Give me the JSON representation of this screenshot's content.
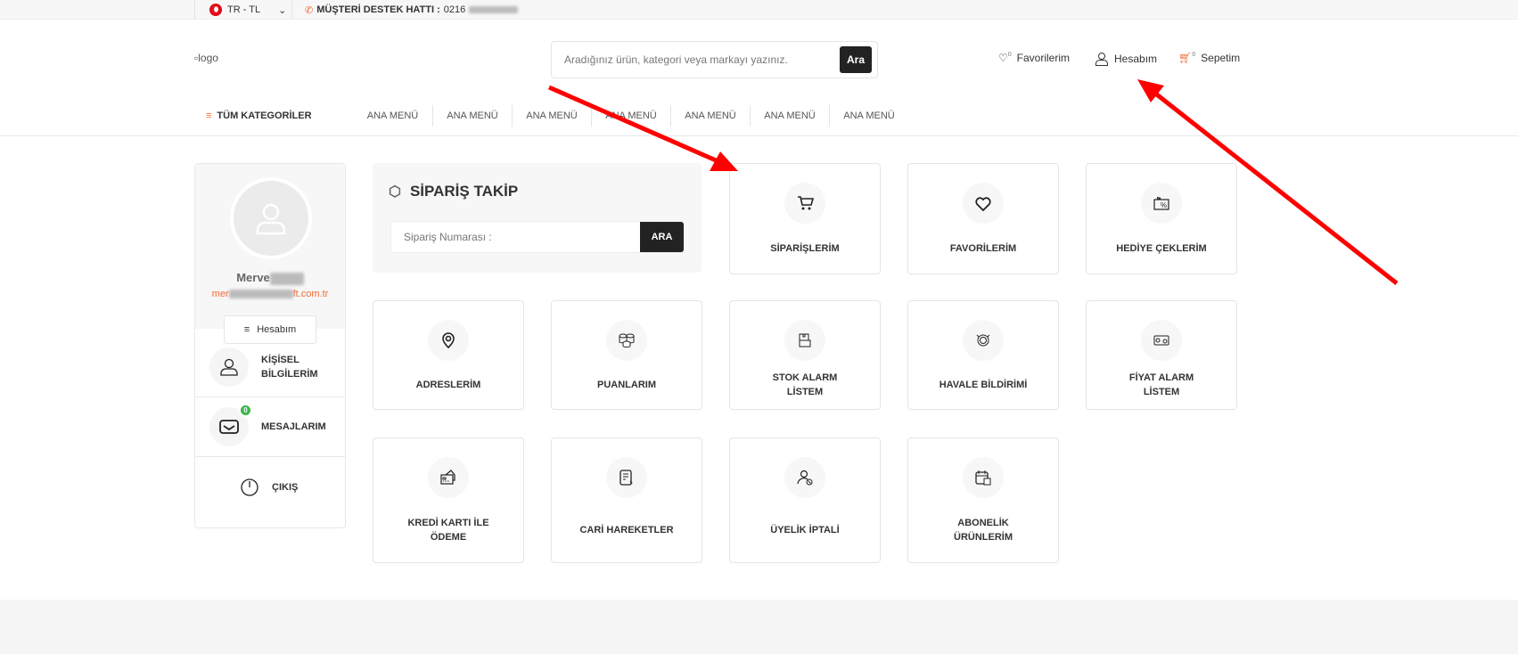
{
  "topbar": {
    "lang": "TR - TL",
    "support_label": "MÜŞTERİ DESTEK HATTI :",
    "support_phone": "0216"
  },
  "header": {
    "logo_alt": "logo",
    "search_placeholder": "Aradığınız ürün, kategori veya markayı yazınız.",
    "search_button": "Ara",
    "favorites": "Favorilerim",
    "favorites_count": "0",
    "account": "Hesabım",
    "cart": "Sepetim",
    "cart_count": "0"
  },
  "nav": {
    "all_categories": "TÜM KATEGORİLER",
    "items": [
      "ANA MENÜ",
      "ANA MENÜ",
      "ANA MENÜ",
      "ANA MENÜ",
      "ANA MENÜ",
      "ANA MENÜ",
      "ANA MENÜ"
    ]
  },
  "sidebar": {
    "name": "Merve",
    "email_start": "mer",
    "email_end": "ft.com.tr",
    "account_button": "Hesabım",
    "items": [
      {
        "label": "KİŞİSEL BİLGİLERİM",
        "icon": "user-icon"
      },
      {
        "label": "MESAJLARIM",
        "icon": "mail-icon",
        "badge": "0"
      },
      {
        "label": "ÇIKIŞ",
        "icon": "power-icon"
      }
    ]
  },
  "tracking": {
    "title": "SİPARİŞ TAKİP",
    "placeholder": "Sipariş Numarası :",
    "button": "ARA"
  },
  "cards": [
    {
      "label": "SİPARİŞLERİM",
      "icon": "cart-icon"
    },
    {
      "label": "FAVORİLERİM",
      "icon": "heart-icon"
    },
    {
      "label": "HEDİYE ÇEKLERİM",
      "icon": "gift-voucher-icon"
    },
    {
      "label": "ADRESLERİM",
      "icon": "location-pin-icon"
    },
    {
      "label": "PUANLARIM",
      "icon": "coins-icon"
    },
    {
      "label": "STOK ALARM LİSTEM",
      "icon": "stock-box-icon"
    },
    {
      "label": "HAVALE BİLDİRİMİ",
      "icon": "money-transfer-icon"
    },
    {
      "label": "FİYAT ALARM LİSTEM",
      "icon": "price-tag-icon"
    },
    {
      "label": "KREDİ KARTI İLE ÖDEME",
      "icon": "credit-card-icon"
    },
    {
      "label": "CARİ HAREKETLER",
      "icon": "statement-icon"
    },
    {
      "label": "ÜYELİK İPTALİ",
      "icon": "user-cancel-icon"
    },
    {
      "label": "ABONELİK ÜRÜNLERİM",
      "icon": "calendar-icon"
    }
  ],
  "colors": {
    "accent": "#f06a35",
    "dark_button": "#222222",
    "badge": "#3bb54a",
    "annotation_arrow": "#ff0000"
  }
}
